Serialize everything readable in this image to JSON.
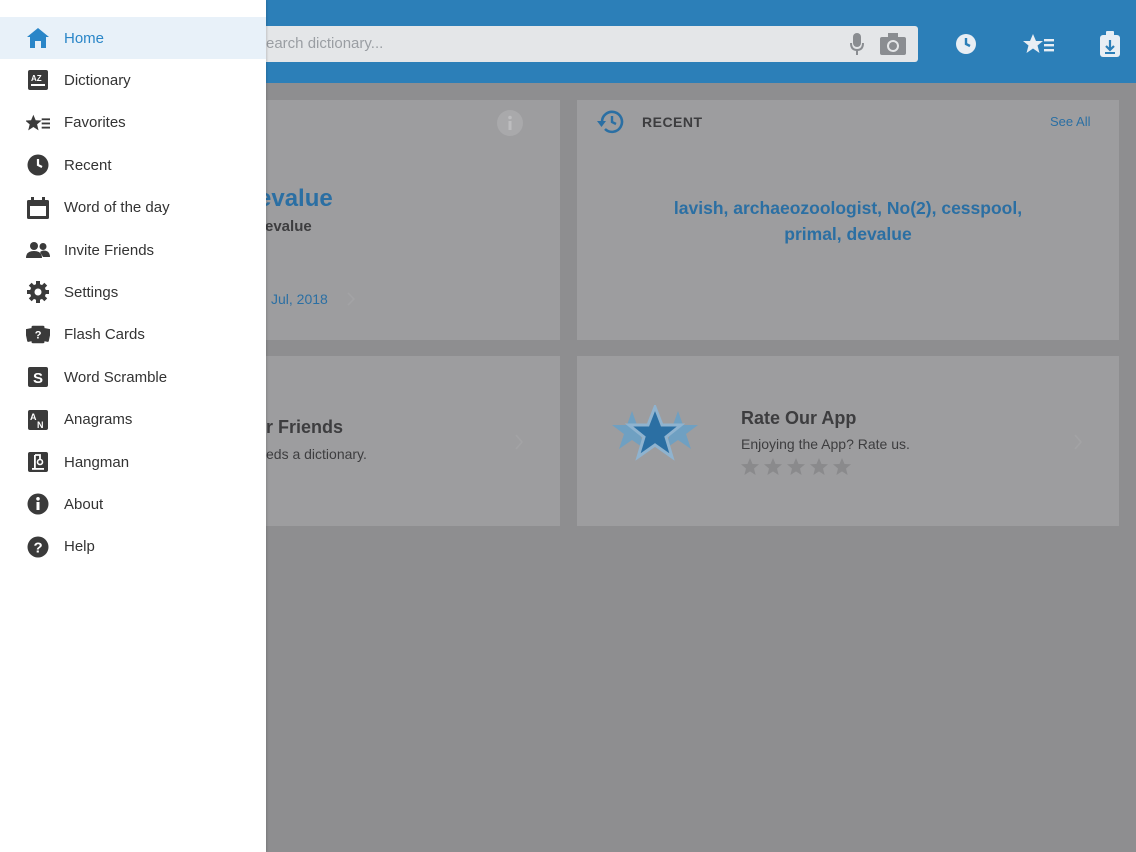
{
  "search": {
    "placeholder": "earch dictionary..."
  },
  "word_card": {
    "word": "evalue",
    "subword": "evalue",
    "date": "Jul, 2018"
  },
  "recent_card": {
    "title": "RECENT",
    "see_all": "See All",
    "words_line1": "lavish, archaeozoologist, No(2), cesspool,",
    "words_line2": "primal, devalue"
  },
  "invite_card": {
    "title": "r Friends",
    "subtitle": "eds a dictionary."
  },
  "rate_card": {
    "title": "Rate Our App",
    "subtitle": "Enjoying the App? Rate us.",
    "rating": 0,
    "max_rating": 5
  },
  "menu": {
    "items": [
      {
        "label": "Home",
        "icon": "home-icon",
        "active": true
      },
      {
        "label": "Dictionary",
        "icon": "dictionary-icon",
        "active": false
      },
      {
        "label": "Favorites",
        "icon": "favorites-icon",
        "active": false
      },
      {
        "label": "Recent",
        "icon": "clock-icon",
        "active": false
      },
      {
        "label": "Word of the day",
        "icon": "calendar-icon",
        "active": false
      },
      {
        "label": "Invite Friends",
        "icon": "people-icon",
        "active": false
      },
      {
        "label": "Settings",
        "icon": "gear-icon",
        "active": false
      },
      {
        "label": "Flash Cards",
        "icon": "flash-cards-icon",
        "active": false
      },
      {
        "label": "Word Scramble",
        "icon": "word-scramble-icon",
        "active": false
      },
      {
        "label": "Anagrams",
        "icon": "anagrams-icon",
        "active": false
      },
      {
        "label": "Hangman",
        "icon": "hangman-icon",
        "active": false
      },
      {
        "label": "About",
        "icon": "info-icon",
        "active": false
      },
      {
        "label": "Help",
        "icon": "help-icon",
        "active": false
      }
    ]
  },
  "colors": {
    "accent": "#2c7fb8",
    "menu_active": "#2a86c8",
    "icon": "#3a3a3a"
  }
}
